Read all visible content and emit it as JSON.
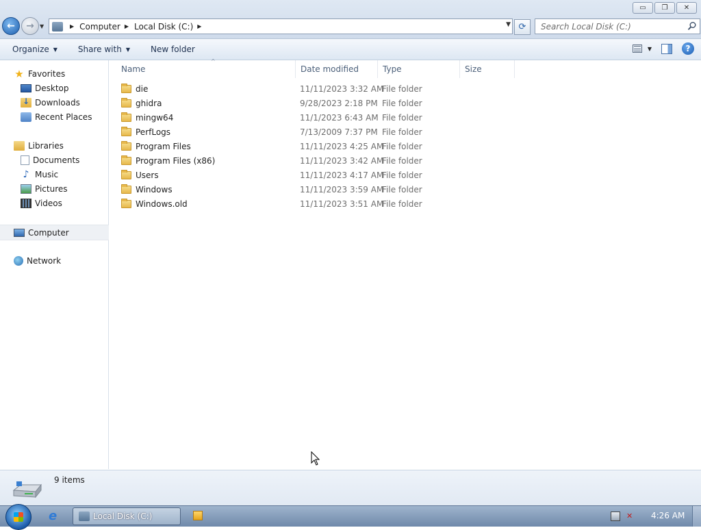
{
  "window": {
    "minimize_glyph": "▭",
    "maximize_glyph": "❐",
    "close_glyph": "✕"
  },
  "address": {
    "location_icon": "computer-drive-icon",
    "crumbs": [
      "Computer",
      "Local Disk (C:)"
    ],
    "search_placeholder": "Search Local Disk (C:)"
  },
  "toolbar": {
    "organize": "Organize",
    "share_with": "Share with",
    "new_folder": "New folder",
    "help": "?"
  },
  "nav": {
    "favorites": {
      "label": "Favorites",
      "items": [
        "Desktop",
        "Downloads",
        "Recent Places"
      ]
    },
    "libraries": {
      "label": "Libraries",
      "items": [
        "Documents",
        "Music",
        "Pictures",
        "Videos"
      ]
    },
    "computer": "Computer",
    "network": "Network"
  },
  "columns": {
    "name": "Name",
    "date_modified": "Date modified",
    "type": "Type",
    "size": "Size",
    "sort_indicator": "^"
  },
  "files": [
    {
      "name": "die",
      "date": "11/11/2023 3:32 AM",
      "type": "File folder"
    },
    {
      "name": "ghidra",
      "date": "9/28/2023 2:18 PM",
      "type": "File folder"
    },
    {
      "name": "mingw64",
      "date": "11/1/2023 6:43 AM",
      "type": "File folder"
    },
    {
      "name": "PerfLogs",
      "date": "7/13/2009 7:37 PM",
      "type": "File folder"
    },
    {
      "name": "Program Files",
      "date": "11/11/2023 4:25 AM",
      "type": "File folder"
    },
    {
      "name": "Program Files (x86)",
      "date": "11/11/2023 3:42 AM",
      "type": "File folder"
    },
    {
      "name": "Users",
      "date": "11/11/2023 4:17 AM",
      "type": "File folder"
    },
    {
      "name": "Windows",
      "date": "11/11/2023 3:59 AM",
      "type": "File folder"
    },
    {
      "name": "Windows.old",
      "date": "11/11/2023 3:51 AM",
      "type": "File folder"
    }
  ],
  "details": {
    "item_count": "9 items"
  },
  "taskbar": {
    "active_window": "Local Disk (C:)",
    "ie_glyph": "e",
    "clock": "4:26 AM"
  },
  "colors": {
    "accent": "#1d5fae",
    "nav_selected_bg": "#eef1f5",
    "column_header_text": "#4c607a",
    "secondary_text": "#6d6d6d"
  }
}
